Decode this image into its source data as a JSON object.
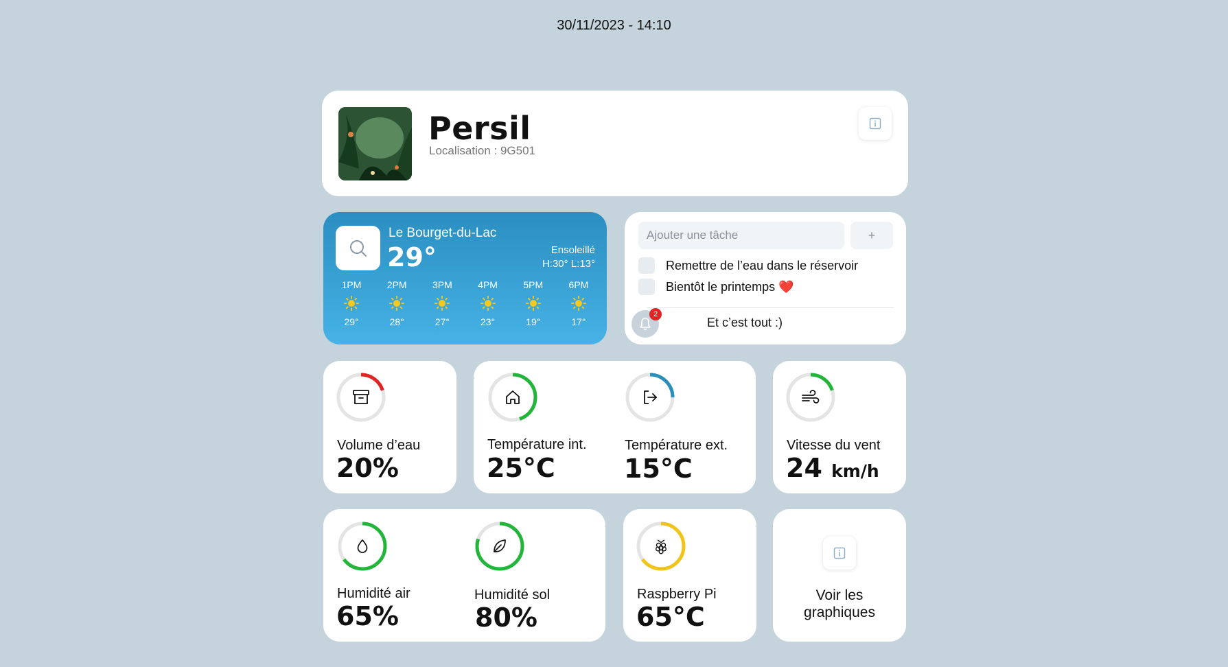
{
  "datetime": "30/11/2023 - 14:10",
  "plant": {
    "name": "Persil",
    "location": "Localisation : 9G501"
  },
  "weather": {
    "city": "Le Bourget-du-Lac",
    "temp": "29°",
    "condition": "Ensoleillé",
    "hilo": "H:30° L:13°",
    "hours": [
      {
        "time": "1PM",
        "temp": "29°"
      },
      {
        "time": "2PM",
        "temp": "28°"
      },
      {
        "time": "3PM",
        "temp": "27°"
      },
      {
        "time": "4PM",
        "temp": "23°"
      },
      {
        "time": "5PM",
        "temp": "19°"
      },
      {
        "time": "6PM",
        "temp": "17°"
      }
    ]
  },
  "tasks": {
    "placeholder": "Ajouter une tâche",
    "add_label": "+",
    "items": [
      {
        "text": "Remettre de l’eau dans le réservoir"
      },
      {
        "text": "Bientôt le printemps ❤️"
      }
    ],
    "notification_count": "2",
    "footer": "Et c’est tout :)"
  },
  "metrics": {
    "water": {
      "label": "Volume d’eau",
      "value": "20%",
      "level": 0.2,
      "color": "#e02424",
      "icon": "archive-icon"
    },
    "temp_int": {
      "label": "Température int.",
      "value": "25°C",
      "level": 0.45,
      "color": "#22b53a",
      "icon": "home-icon"
    },
    "temp_ext": {
      "label": "Température ext.",
      "value": "15°C",
      "level": 0.25,
      "color": "#2a8fb8",
      "icon": "logout-icon"
    },
    "wind": {
      "label": "Vitesse du vent",
      "value": "24",
      "unit": "km/h",
      "level": 0.2,
      "color": "#22b53a",
      "icon": "wind-icon"
    },
    "humidity_air": {
      "label": "Humidité air",
      "value": "65%",
      "level": 0.65,
      "color": "#22b53a",
      "icon": "droplet-icon"
    },
    "humidity_soil": {
      "label": "Humidité sol",
      "value": "80%",
      "level": 0.8,
      "color": "#22b53a",
      "icon": "leaf-icon"
    },
    "raspberry": {
      "label": "Raspberry Pi",
      "value": "65°C",
      "level": 0.65,
      "color": "#f0c419",
      "icon": "raspberry-icon"
    }
  },
  "graphs": {
    "label": "Voir les graphiques"
  }
}
